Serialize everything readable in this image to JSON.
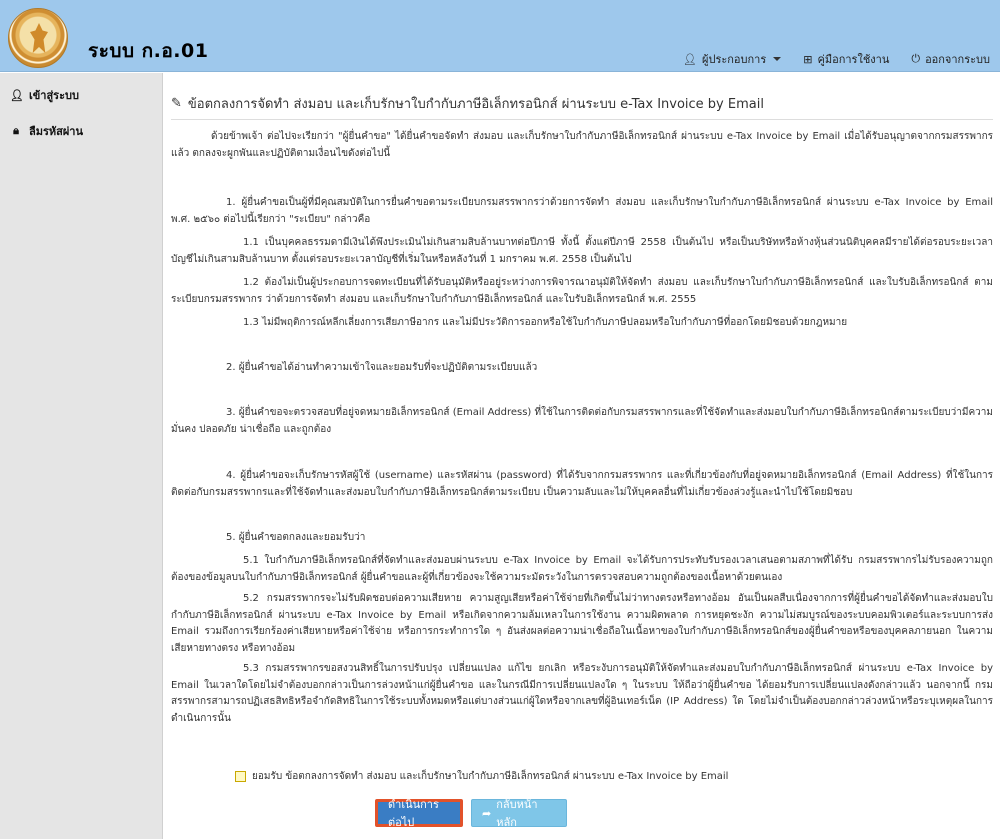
{
  "header": {
    "app_title": "ระบบ ก.อ.01",
    "nav": {
      "operator": "ผู้ประกอบการ",
      "manual": "คู่มือการใช้งาน",
      "logout": "ออกจากระบบ"
    }
  },
  "sidebar": {
    "items": [
      {
        "label": "เข้าสู่ระบบ",
        "icon": "user-icon"
      },
      {
        "label": "ลืมรหัสผ่าน",
        "icon": "lock-icon"
      }
    ]
  },
  "main": {
    "title": "ข้อตกลงการจัดทำ ส่งมอบ และเก็บรักษาใบกำกับภาษีอิเล็กทรอนิกส์ ผ่านระบบ e-Tax Invoice by Email",
    "paragraphs": [
      "ด้วยข้าพเจ้า ต่อไปจะเรียกว่า \"ผู้ยื่นคำขอ\" ได้ยื่นคำขอจัดทำ ส่งมอบ และเก็บรักษาใบกำกับภาษีอิเล็กทรอนิกส์ ผ่านระบบ e-Tax Invoice by Email เมื่อได้รับอนุญาตจากกรมสรรพากรแล้ว ตกลงจะผูกพันและปฏิบัติตามเงื่อนไขดังต่อไปนี้",
      "1. ผู้ยื่นคำขอเป็นผู้ที่มีคุณสมบัติในการยื่นคำขอตามระเบียบกรมสรรพากรว่าด้วยการจัดทำ ส่งมอบ และเก็บรักษาใบกำกับภาษีอิเล็กทรอนิกส์ ผ่านระบบ e-Tax Invoice by Email พ.ศ. ๒๕๖๐ ต่อไปนี้เรียกว่า \"ระเบียบ\" กล่าวคือ",
      "1.1 เป็นบุคคลธรรมดามีเงินได้พึงประเมินไม่เกินสามสิบล้านบาทต่อปีภาษี ทั้งนี้ ตั้งแต่ปีภาษี 2558 เป็นต้นไป หรือเป็นบริษัทหรือห้างหุ้นส่วนนิติบุคคลมีรายได้ต่อรอบระยะเวลาบัญชีไม่เกินสามสิบล้านบาท ตั้งแต่รอบระยะเวลาบัญชีที่เริ่มในหรือหลังวันที่ 1 มกราคม พ.ศ. 2558 เป็นต้นไป",
      "1.2 ต้องไม่เป็นผู้ประกอบการจดทะเบียนที่ได้รับอนุมัติหรืออยู่ระหว่างการพิจารณาอนุมัติให้จัดทำ ส่งมอบ และเก็บรักษาใบกำกับภาษีอิเล็กทรอนิกส์ และใบรับอิเล็กทรอนิกส์ ตามระเบียบกรมสรรพากร ว่าด้วยการจัดทำ ส่งมอบ และเก็บรักษาใบกำกับภาษีอิเล็กทรอนิกส์ และใบรับอิเล็กทรอนิกส์ พ.ศ. 2555",
      "1.3 ไม่มีพฤติการณ์หลีกเลี่ยงการเสียภาษีอากร และไม่มีประวัติการออกหรือใช้ใบกำกับภาษีปลอมหรือใบกำกับภาษีที่ออกโดยมิชอบด้วยกฎหมาย",
      "2. ผู้ยื่นคำขอได้อ่านทำความเข้าใจและยอมรับที่จะปฏิบัติตามระเบียบแล้ว",
      "3. ผู้ยื่นคำขอจะตรวจสอบที่อยู่จดหมายอิเล็กทรอนิกส์ (Email Address) ที่ใช้ในการติดต่อกับกรมสรรพากรและที่ใช้จัดทำและส่งมอบใบกำกับภาษีอิเล็กทรอนิกส์ตามระเบียบว่ามีความมั่นคง ปลอดภัย น่าเชื่อถือ และถูกต้อง",
      "4. ผู้ยื่นคำขอจะเก็บรักษารหัสผู้ใช้ (username) และรหัสผ่าน (password) ที่ได้รับจากกรมสรรพากร และที่เกี่ยวข้องกับที่อยู่จดหมายอิเล็กทรอนิกส์ (Email Address) ที่ใช้ในการติดต่อกับกรมสรรพากรและที่ใช้จัดทำและส่งมอบใบกำกับภาษีอิเล็กทรอนิกส์ตามระเบียบ เป็นความลับและไม่ให้บุคคลอื่นที่ไม่เกี่ยวข้องล่วงรู้และนำไปใช้โดยมิชอบ",
      "5. ผู้ยื่นคำขอตกลงและยอมรับว่า",
      "5.1 ใบกำกับภาษีอิเล็กทรอนิกส์ที่จัดทำและส่งมอบผ่านระบบ e-Tax Invoice by Email จะได้รับการประทับรับรองเวลาเสนอตามสภาพที่ได้รับ กรมสรรพากรไม่รับรองความถูกต้องของข้อมูลบนใบกำกับภาษีอิเล็กทรอนิกส์ ผู้ยื่นคำขอและผู้ที่เกี่ยวข้องจะใช้ความระมัดระวังในการตรวจสอบความถูกต้องของเนื้อหาด้วยตนเอง",
      "5.2 กรมสรรพากรจะไม่รับผิดชอบต่อความเสียหาย ความสูญเสียหรือค่าใช้จ่ายที่เกิดขึ้นไม่ว่าทางตรงหรือทางอ้อม อันเป็นผลสืบเนื่องจากการที่ผู้ยื่นคำขอได้จัดทำและส่งมอบใบกำกับภาษีอิเล็กทรอนิกส์ ผ่านระบบ e-Tax Invoice by Email หรือเกิดจากความล้มเหลวในการใช้งาน ความผิดพลาด การหยุดชะงัก ความไม่สมบูรณ์ของระบบคอมพิวเตอร์และระบบการส่ง Email รวมถึงการเรียกร้องค่าเสียหายหรือค่าใช้จ่าย หรือการกระทำการใด ๆ อันส่งผลต่อความน่าเชื่อถือในเนื้อหาของใบกำกับภาษีอิเล็กทรอนิกส์ของผู้ยื่นคำขอหรือของบุคคลภายนอก ในความเสียหายทางตรง หรือทางอ้อม",
      "5.3 กรมสรรพากรขอสงวนสิทธิ์ในการปรับปรุง เปลี่ยนแปลง แก้ไข ยกเลิก หรือระงับการอนุมัติให้จัดทำและส่งมอบใบกำกับภาษีอิเล็กทรอนิกส์ ผ่านระบบ e-Tax Invoice by Email ในเวลาใดโดยไม่จำต้องบอกกล่าวเป็นการล่วงหน้าแก่ผู้ยื่นคำขอ และในกรณีมีการเปลี่ยนแปลงใด ๆ ในระบบ ให้ถือว่าผู้ยื่นคำขอ ได้ยอมรับการเปลี่ยนแปลงดังกล่าวแล้ว นอกจากนี้ กรมสรรพากรสามารถปฏิเสธสิทธิหรือจำกัดสิทธิในการใช้ระบบทั้งหมดหรือแต่บางส่วนแก่ผู้ใดหรือจากเลขที่ผู้อินเทอร์เน็ต (IP Address) ใด โดยไม่จำเป็นต้องบอกกล่าวล่วงหน้าหรือระบุเหตุผลในการดำเนินการนั้น"
    ],
    "accept_label": "ยอมรับ ข้อตกลงการจัดทำ ส่งมอบ และเก็บรักษาใบกำกับภาษีอิเล็กทรอนิกส์ ผ่านระบบ e-Tax Invoice by Email",
    "buttons": {
      "continue": "ดำเนินการต่อไป",
      "back": "กลับหน้าหลัก"
    }
  },
  "colors": {
    "header_bg": "#9ec8ec",
    "sidebar_bg": "#e5e5e5",
    "primary_button": "#3a7dc4",
    "secondary_button": "#7fc6e8",
    "highlight_border": "#e2522a"
  }
}
